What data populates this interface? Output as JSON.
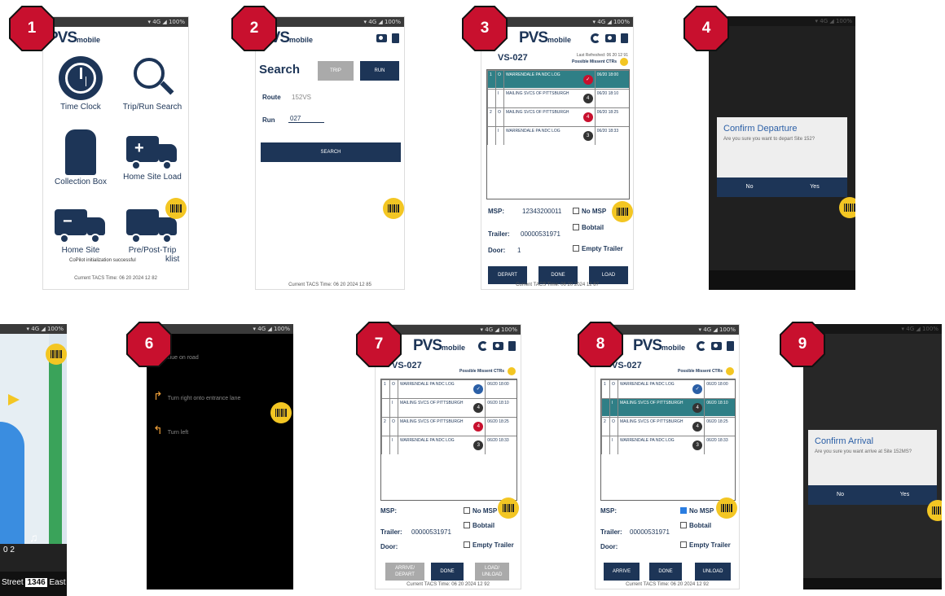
{
  "status": {
    "time_left": "",
    "right": "▾ 4G ◢ 100%"
  },
  "logo": {
    "main": "PVS",
    "sub": "mobile"
  },
  "steps": [
    "1",
    "2",
    "3",
    "4",
    "6",
    "7",
    "8",
    "9"
  ],
  "home": {
    "tiles": [
      "Time Clock",
      "Trip/Run Search",
      "Collection Box",
      "Home Site Load",
      "Home Site",
      "Pre/Post-Trip"
    ],
    "klist": "klist",
    "toast": "CoPilot initialization successful",
    "footer": "Current TACS Time: 06 20 2024 12 82"
  },
  "search": {
    "title": "Search",
    "trip": "TRIP",
    "run_tab": "RUN",
    "route_label": "Route",
    "route_value": "152VS",
    "run_label": "Run",
    "run_value": "027",
    "button": "SEARCH",
    "footer": "Current TACS Time: 06 20 2024 12 85"
  },
  "trip": {
    "id": "VS-027",
    "id7": "VS-027",
    "last_refreshed": "Last Refreshed: 06 20 12 91",
    "missent": "Possible Missent CTRs",
    "rows": [
      {
        "grp": "1",
        "dir": "O",
        "site": "WARRENDALE PA NDC LOG",
        "badge": "✓",
        "time": "06/20 18:00"
      },
      {
        "grp": "",
        "dir": "I",
        "site": "MAILING SVCS OF PITTSBURGH",
        "badge": "4",
        "time": "06/20 18:10"
      },
      {
        "grp": "2",
        "dir": "O",
        "site": "MAILING SVCS OF PITTSBURGH",
        "badge": "4",
        "time": "06/20 18:25"
      },
      {
        "grp": "",
        "dir": "I",
        "site": "WARRENDALE PA NDC LOG",
        "badge": "3",
        "time": "06/20 18:33"
      }
    ],
    "msp_label": "MSP:",
    "msp_value": "12343200011",
    "trailer_label": "Trailer:",
    "trailer_value": "00000531971",
    "door_label": "Door:",
    "door_value": "1",
    "no_msp": "No MSP",
    "bobtail": "Bobtail",
    "empty_trailer": "Empty Trailer",
    "depart": "DEPART",
    "done": "DONE",
    "load": "LOAD",
    "footer": "Current TACS Time: 06 20 2024 12 87"
  },
  "confirm_departure": {
    "title": "Confirm Departure",
    "msg": "Are you sure you want to depart Site 152?",
    "no": "No",
    "yes": "Yes"
  },
  "nav": {
    "road": "Street",
    "route_num": "1346",
    "dir": "East",
    "time": "0 2"
  },
  "turns": [
    {
      "icon": "",
      "text": "Continue on road"
    },
    {
      "icon": "↱",
      "text": "Turn right onto entrance lane"
    },
    {
      "icon": "↰",
      "text": "Turn left"
    }
  ],
  "step7": {
    "arrive_depart": "ARRIVE/ DEPART",
    "done": "DONE",
    "load_unload": "LOAD/ UNLOAD",
    "footer": "Current TACS Time: 06 20 2024 12 92"
  },
  "step8": {
    "arrive": "ARRIVE",
    "done": "DONE",
    "unload": "UNLOAD",
    "footer": "Current TACS Time: 06 20 2024 12 92"
  },
  "confirm_arrival": {
    "title": "Confirm Arrival",
    "msg": "Are you sure you want arrive at Site 152MS?",
    "no": "No",
    "yes": "Yes"
  },
  "colors": {
    "navy": "#1d3557",
    "badge_red": "#c8102e",
    "scan_yellow": "#f3c623",
    "teal": "#2f7f86",
    "green": "#3aa35a"
  }
}
